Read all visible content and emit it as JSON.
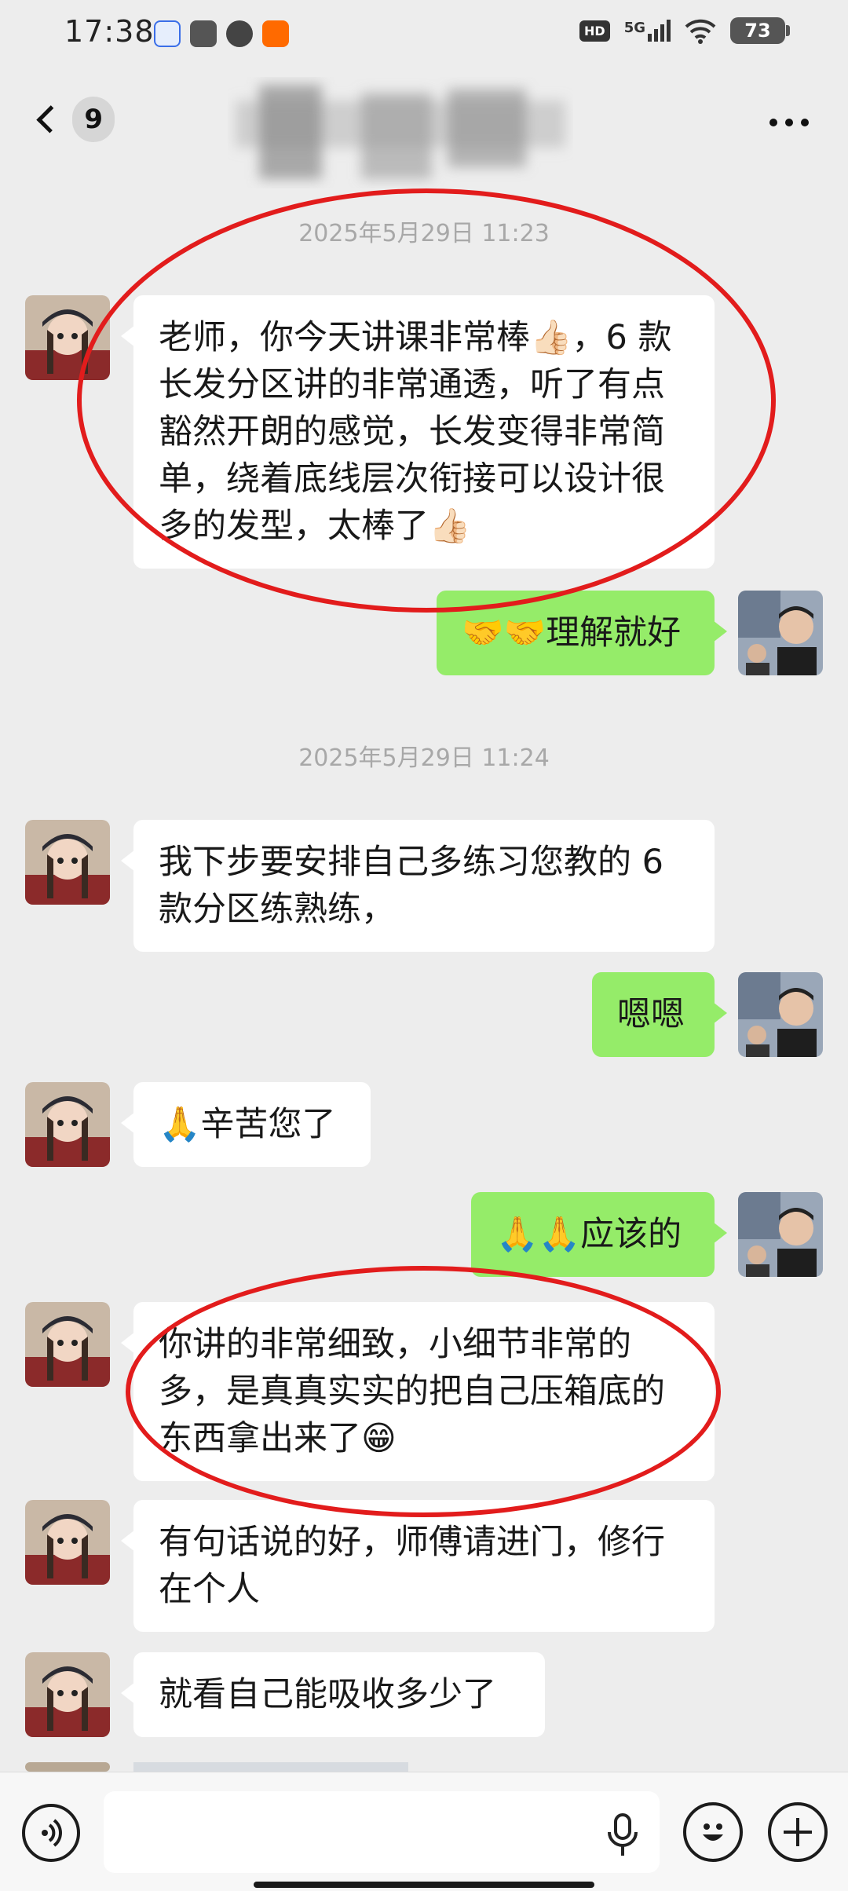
{
  "status_bar": {
    "time": "17:38",
    "network": "5G",
    "hd": "HD",
    "battery": "73"
  },
  "nav": {
    "unread_count": "9"
  },
  "messages": [
    {
      "type": "timestamp",
      "text": "2025年5月29日 11:23"
    },
    {
      "type": "in",
      "text": "老师，你今天讲课非常棒👍🏻，6 款长发分区讲的非常通透，听了有点豁然开朗的感觉，长发变得非常简单，绕着底线层次衔接可以设计很多的发型，太棒了👍🏻"
    },
    {
      "type": "out",
      "text": "🤝🤝理解就好"
    },
    {
      "type": "timestamp",
      "text": "2025年5月29日 11:24"
    },
    {
      "type": "in",
      "text": "我下步要安排自己多练习您教的 6 款分区练熟练，"
    },
    {
      "type": "out",
      "text": "嗯嗯"
    },
    {
      "type": "in",
      "text": "🙏辛苦您了"
    },
    {
      "type": "out",
      "text": "🙏🙏应该的"
    },
    {
      "type": "in",
      "text": "你讲的非常细致，小细节非常的多，是真真实实的把自己压箱底的东西拿出来了😁"
    },
    {
      "type": "in",
      "text": "有句话说的好，师傅请进门，修行在个人"
    },
    {
      "type": "in",
      "text": "就看自己能吸收多少了"
    }
  ],
  "input": {
    "placeholder": ""
  },
  "colors": {
    "background": "#ededed",
    "bubble_in": "#ffffff",
    "bubble_out": "#95ec69",
    "annotation": "#e21c1c"
  },
  "icons": [
    "back-chevron-icon",
    "more-icon",
    "voice-mode-icon",
    "mic-icon",
    "emoji-icon",
    "plus-icon"
  ]
}
